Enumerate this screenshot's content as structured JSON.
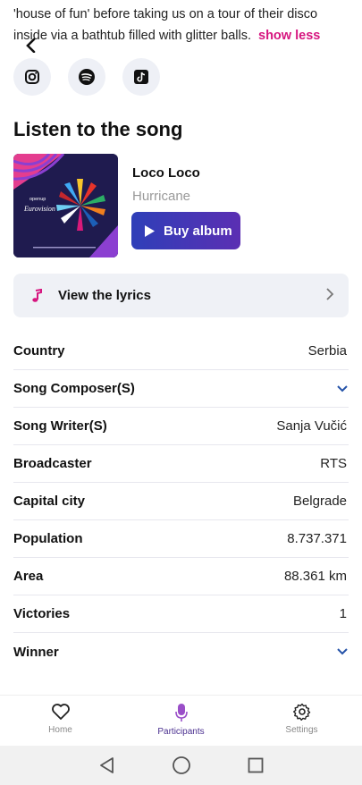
{
  "intro": {
    "text": "'house of fun' before taking us on a tour of their disco inside via a bathtub filled with glitter balls.",
    "show_less": "show less"
  },
  "socials": [
    "instagram-icon",
    "spotify-icon",
    "tiktok-icon"
  ],
  "listen": {
    "title": "Listen to the song",
    "song": "Loco Loco",
    "artist": "Hurricane",
    "buy_label": "Buy album",
    "album_art_text": {
      "brand": "openup",
      "event": "Eurovision"
    }
  },
  "lyrics": {
    "label": "View the lyrics"
  },
  "facts": [
    {
      "key": "Country",
      "value": "Serbia"
    },
    {
      "key": "Song Composer(S)",
      "value": ""
    },
    {
      "key": "Song Writer(S)",
      "value": "Sanja Vučić"
    },
    {
      "key": "Broadcaster",
      "value": "RTS"
    },
    {
      "key": "Capital city",
      "value": "Belgrade"
    },
    {
      "key": "Population",
      "value": "8.737.371"
    },
    {
      "key": "Area",
      "value": "88.361 km"
    },
    {
      "key": "Victories",
      "value": "1"
    },
    {
      "key": "Winner",
      "value": ""
    }
  ],
  "tabs": [
    {
      "label": "Home",
      "icon": "heart-icon"
    },
    {
      "label": "Participants",
      "icon": "microphone-icon",
      "active": true
    },
    {
      "label": "Settings",
      "icon": "gear-icon"
    }
  ],
  "colors": {
    "accent": "#d6157f",
    "button_start": "#2e3fb8",
    "button_end": "#5b2fb3",
    "active_tab": "#4a2f8f"
  }
}
